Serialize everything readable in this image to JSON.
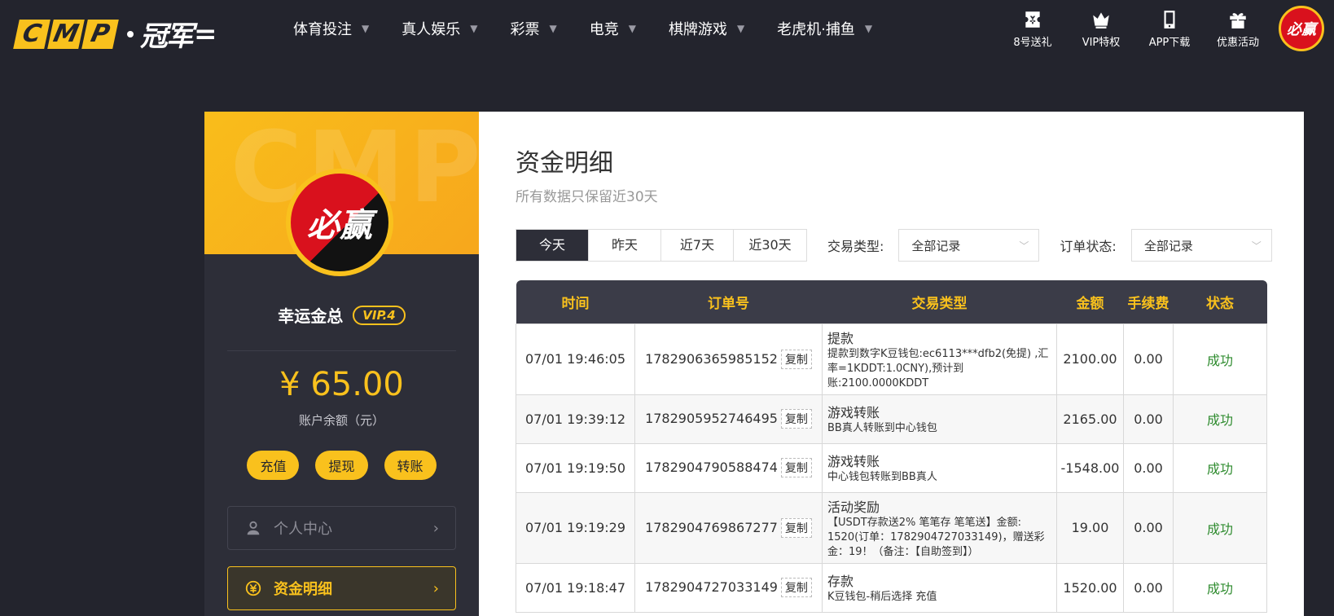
{
  "brand": {
    "logo_letters": [
      "C",
      "M",
      "P"
    ],
    "logo_cn": "冠军",
    "logo_tail": "="
  },
  "nav": [
    {
      "label": "体育投注"
    },
    {
      "label": "真人娱乐"
    },
    {
      "label": "彩票"
    },
    {
      "label": "电竞"
    },
    {
      "label": "棋牌游戏"
    },
    {
      "label": "老虎机·捕鱼"
    }
  ],
  "tools": [
    {
      "label": "8号送礼",
      "icon": "ticket-icon"
    },
    {
      "label": "VIP特权",
      "icon": "crown-icon"
    },
    {
      "label": "APP下载",
      "icon": "phone-icon"
    },
    {
      "label": "优惠活动",
      "icon": "gift-icon"
    }
  ],
  "avatar_text": "必赢",
  "sidebar": {
    "watermark": "CMP",
    "username": "幸运金总",
    "vip": "VIP.4",
    "balance": "¥ 65.00",
    "balance_label": "账户余额（元）",
    "actions": [
      "充值",
      "提现",
      "转账"
    ],
    "links": [
      {
        "label": "个人中心",
        "icon": "user-icon",
        "arrow": "›"
      },
      {
        "label": "资金明细",
        "icon": "currency-icon",
        "arrow": "›"
      }
    ]
  },
  "main": {
    "title": "资金明细",
    "subtitle": "所有数据只保留近30天",
    "range_tabs": [
      "今天",
      "昨天",
      "近7天",
      "近30天"
    ],
    "active_range": 0,
    "filter_type_label": "交易类型:",
    "filter_type_value": "全部记录",
    "filter_status_label": "订单状态:",
    "filter_status_value": "全部记录",
    "copy_label": "复制",
    "columns": [
      "时间",
      "订单号",
      "交易类型",
      "金额",
      "手续费",
      "状态"
    ],
    "rows": [
      {
        "time": "07/01 19:46:05",
        "order": "1782906365985152",
        "type": "提款",
        "desc": "提款到数字K豆钱包:ec6113***dfb2(免提) ,汇率=1KDDT:1.0CNY),预计到账:2100.0000KDDT",
        "amount": "2100.00",
        "fee": "0.00",
        "status": "成功"
      },
      {
        "time": "07/01 19:39:12",
        "order": "1782905952746495",
        "type": "游戏转账",
        "desc": "BB真人转账到中心钱包",
        "amount": "2165.00",
        "fee": "0.00",
        "status": "成功"
      },
      {
        "time": "07/01 19:19:50",
        "order": "1782904790588474",
        "type": "游戏转账",
        "desc": "中心钱包转账到BB真人",
        "amount": "-1548.00",
        "fee": "0.00",
        "status": "成功"
      },
      {
        "time": "07/01 19:19:29",
        "order": "1782904769867277",
        "type": "活动奖励",
        "desc": "【USDT存款送2% 笔笔存 笔笔送】金额: 1520(订单：1782904727033149)，赠送彩金：19！（备注：【自助签到】）",
        "amount": "19.00",
        "fee": "0.00",
        "status": "成功"
      },
      {
        "time": "07/01 19:18:47",
        "order": "1782904727033149",
        "type": "存款",
        "desc": "K豆钱包-稍后选择 充值",
        "amount": "1520.00",
        "fee": "0.00",
        "status": "成功"
      }
    ]
  }
}
